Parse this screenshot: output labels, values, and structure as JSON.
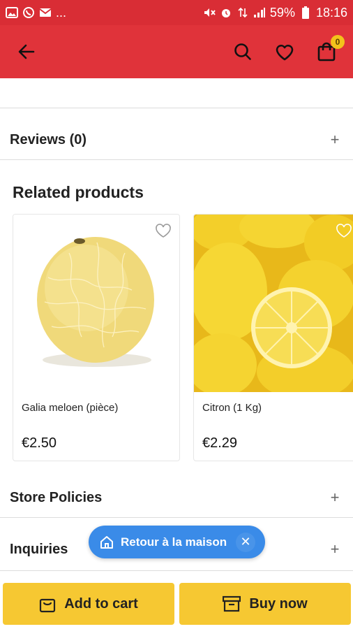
{
  "status_bar": {
    "left_icons": [
      "gallery-icon",
      "whatsapp-icon",
      "mail-icon"
    ],
    "more": "...",
    "battery": "59%",
    "time": "18:16"
  },
  "app_bar": {
    "cart_count": "0",
    "accent": "#e0333a"
  },
  "sections": {
    "reviews": "Reviews (0)",
    "store_policies": "Store Policies",
    "inquiries": "Inquiries",
    "expand_symbol": "+"
  },
  "related": {
    "title": "Related products",
    "products": [
      {
        "name": "Galia meloen (pièce)",
        "price": "€2.50"
      },
      {
        "name": "Citron (1 Kg)",
        "price": "€2.29"
      }
    ]
  },
  "toast": {
    "label": "Retour à la maison",
    "close": "✕"
  },
  "bottom_bar": {
    "add_to_cart": "Add to cart",
    "buy_now": "Buy now",
    "button_color": "#f6c832"
  }
}
